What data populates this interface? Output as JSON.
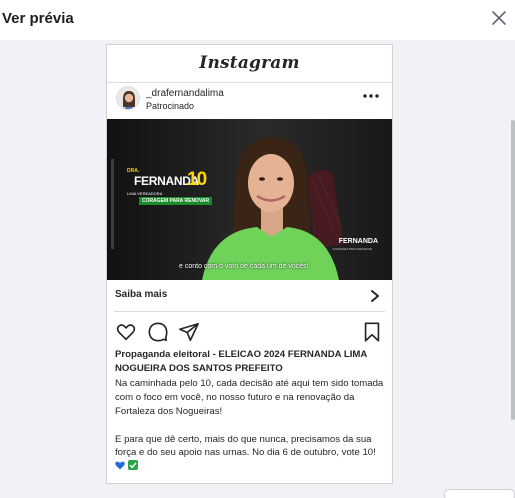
{
  "dialog": {
    "title": "Ver prévia",
    "close_icon": "close-icon"
  },
  "instagram": {
    "logo_text": "Instagram",
    "post": {
      "username": "_drafernandalima",
      "sponsored_label": "Patrocinado",
      "media": {
        "name_prefix": "DRA.",
        "name": "FERNANDA",
        "number": "10",
        "surname_line": "LIMA VEREADORA",
        "slogan": "CORAGEM PARA RENOVAR",
        "subtitle": "e conto com o voto de cada um de vocês!",
        "corner_logo": "FERNANDA",
        "corner_logo_sub": "CORAGEM PARA RENOVAR",
        "shirt_color": "#6fd35a",
        "background_color": "#1a1a1a"
      },
      "cta_label": "Saiba mais",
      "caption_title": "Propaganda eleitoral - ELEICAO 2024 FERNANDA LIMA NOGUEIRA DOS SANTOS PREFEITO",
      "caption_para1": "Na caminhada pelo 10, cada decisão até aqui tem sido tomada com o foco em você, no nosso futuro e na renovação da Fortaleza dos Nogueiras!",
      "caption_para2": "E para que dê certo, mais do que nunca, precisamos da sua força e do seu apoio nas urnas. No dia 6 de outubro, vote 10!"
    }
  },
  "colors": {
    "accent_yellow": "#ffd400",
    "slogan_green": "#1a8a2a",
    "check_green": "#2aa64a",
    "heart_blue": "#1f6fd6"
  }
}
